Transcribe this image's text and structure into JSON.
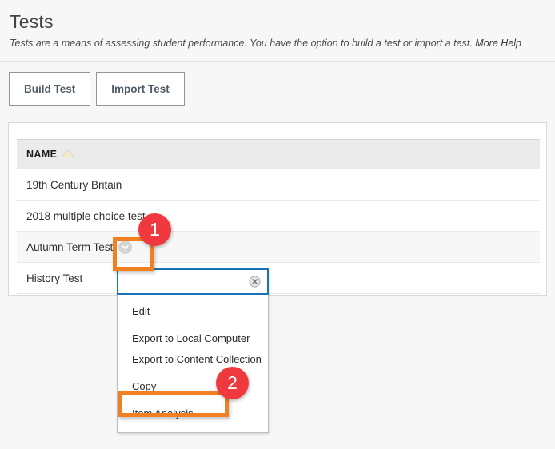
{
  "page": {
    "title": "Tests",
    "description_prefix": "Tests are a means of assessing student performance. You have the option to build a test or import a test. ",
    "more_help_label": "More Help"
  },
  "action_bar": {
    "buttons": [
      {
        "label": "Build Test",
        "name": "build-test-button"
      },
      {
        "label": "Import Test",
        "name": "import-test-button"
      }
    ]
  },
  "table": {
    "columns": [
      {
        "label": "NAME",
        "sort_icon": "sort-ascending-triangle-icon"
      }
    ],
    "rows": [
      {
        "name": "19th Century Britain",
        "has_menu_chevron": false,
        "shaded": false
      },
      {
        "name": "2018 multiple choice test",
        "has_menu_chevron": false,
        "shaded": false
      },
      {
        "name": "Autumn Term Test",
        "has_menu_chevron": true,
        "shaded": true
      },
      {
        "name": "History Test",
        "has_menu_chevron": false,
        "shaded": false
      }
    ]
  },
  "context_menu": {
    "close_icon": "close-circle-icon",
    "items": [
      {
        "label": "Edit",
        "group_gap": false
      },
      {
        "label": "Export to Local Computer",
        "group_gap": true
      },
      {
        "label": "Export to Content Collection",
        "group_gap": false
      },
      {
        "label": "Copy",
        "group_gap": true
      },
      {
        "label": "Item Analysis",
        "group_gap": true
      }
    ]
  },
  "annotations": {
    "badges": [
      {
        "label": "1"
      },
      {
        "label": "2"
      }
    ],
    "highlight_color": "#f08022",
    "badge_color": "#f0393f"
  }
}
